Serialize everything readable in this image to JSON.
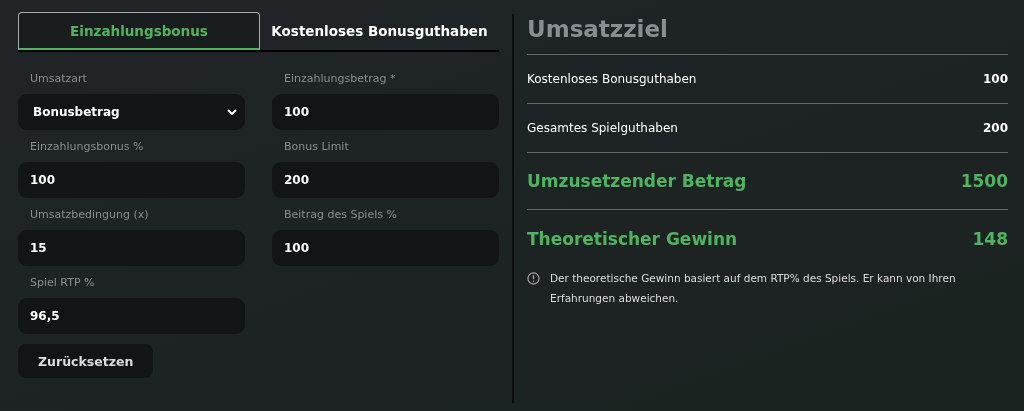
{
  "tabs": [
    {
      "label": "Einzahlungsbonus",
      "selected": true
    },
    {
      "label": "Kostenloses Bonusguthaben",
      "selected": false
    }
  ],
  "form": {
    "columns": [
      [
        {
          "kind": "select",
          "label": "Umsatzart",
          "value": "Bonusbetrag"
        },
        {
          "kind": "input",
          "label": "Einzahlungsbonus %",
          "value": "100"
        },
        {
          "kind": "input",
          "label": "Umsatzbedingung (x)",
          "value": "15"
        },
        {
          "kind": "input",
          "label": "Spiel RTP %",
          "value": "96,5"
        }
      ],
      [
        {
          "kind": "input",
          "label": "Einzahlungsbetrag *",
          "value": "100"
        },
        {
          "kind": "input",
          "label": "Bonus Limit",
          "value": "200"
        },
        {
          "kind": "input",
          "label": "Beitrag des Spiels %",
          "value": "100"
        }
      ]
    ],
    "reset_button": "Zurücksetzen"
  },
  "summary": {
    "title": "Umsatzziel",
    "rows": [
      {
        "kind": "plain",
        "label": "Kostenloses Bonusguthaben",
        "value": "100"
      },
      {
        "kind": "plain",
        "label": "Gesamtes Spielguthaben",
        "value": "200"
      },
      {
        "kind": "highlight",
        "label": "Umzusetzender Betrag",
        "value": "1500"
      },
      {
        "kind": "highlight",
        "label": "Theoretischer Gewinn",
        "value": "148"
      }
    ],
    "note": "Der theoretische Gewinn basiert auf dem RTP% des Spiels. Er kann von Ihren Erfahrungen abweichen."
  }
}
